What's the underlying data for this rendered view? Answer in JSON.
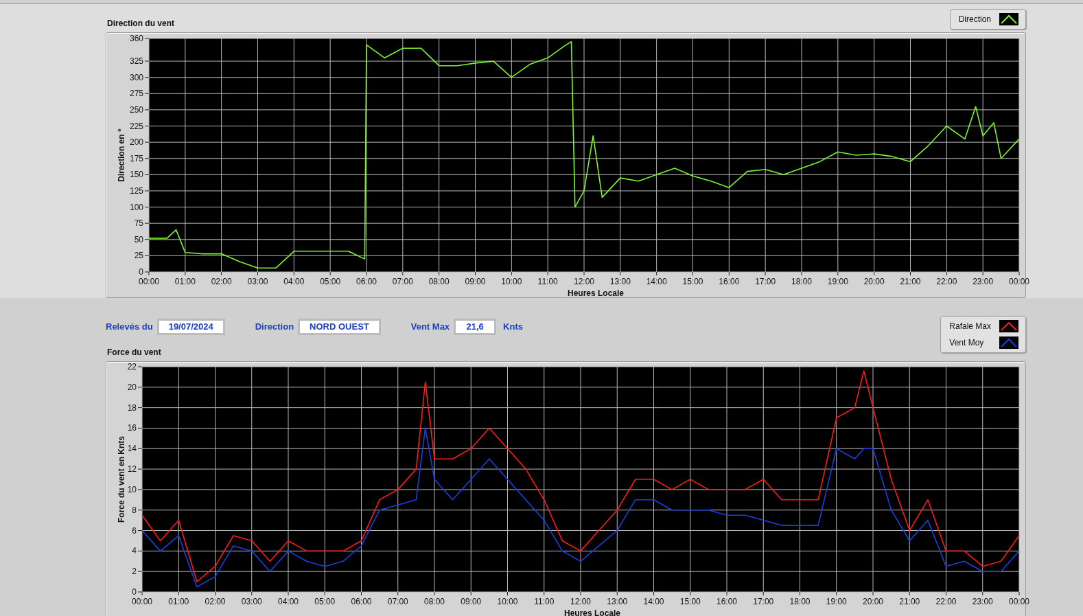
{
  "direction_chart": {
    "title": "Direction du vent",
    "chart_data": {
      "type": "line",
      "grid": true,
      "xlabel": "Heures Locale",
      "ylabel": "Direction en °",
      "xlim": [
        0,
        24
      ],
      "ylim": [
        0,
        360
      ],
      "xticks": [
        {
          "value": 0,
          "label": "00:00"
        },
        {
          "value": 1,
          "label": "01:00"
        },
        {
          "value": 2,
          "label": "02:00"
        },
        {
          "value": 3,
          "label": "03:00"
        },
        {
          "value": 4,
          "label": "04:00"
        },
        {
          "value": 5,
          "label": "05:00"
        },
        {
          "value": 6,
          "label": "06:00"
        },
        {
          "value": 7,
          "label": "07:00"
        },
        {
          "value": 8,
          "label": "08:00"
        },
        {
          "value": 9,
          "label": "09:00"
        },
        {
          "value": 10,
          "label": "10:00"
        },
        {
          "value": 11,
          "label": "11:00"
        },
        {
          "value": 12,
          "label": "12:00"
        },
        {
          "value": 13,
          "label": "13:00"
        },
        {
          "value": 14,
          "label": "14:00"
        },
        {
          "value": 15,
          "label": "15:00"
        },
        {
          "value": 16,
          "label": "16:00"
        },
        {
          "value": 17,
          "label": "17:00"
        },
        {
          "value": 18,
          "label": "18:00"
        },
        {
          "value": 19,
          "label": "19:00"
        },
        {
          "value": 20,
          "label": "20:00"
        },
        {
          "value": 21,
          "label": "21:00"
        },
        {
          "value": 22,
          "label": "22:00"
        },
        {
          "value": 23,
          "label": "23:00"
        },
        {
          "value": 24,
          "label": "00:00"
        }
      ],
      "yticks": [
        0,
        25,
        50,
        75,
        100,
        125,
        150,
        175,
        200,
        225,
        250,
        275,
        300,
        325,
        360
      ],
      "x": [
        0,
        0.5,
        0.75,
        1,
        1.5,
        2,
        2.5,
        3,
        3.5,
        4,
        4.5,
        5,
        5.5,
        5.95,
        6,
        6.5,
        7,
        7.5,
        8,
        8.5,
        9,
        9.5,
        10,
        10.5,
        11,
        11.5,
        11.65,
        11.75,
        12,
        12.25,
        12.5,
        13,
        13.5,
        14,
        14.5,
        15,
        15.5,
        16,
        16.5,
        17,
        17.5,
        18,
        18.5,
        19,
        19.5,
        20,
        20.5,
        21,
        21.5,
        22,
        22.5,
        22.8,
        23,
        23.3,
        23.5,
        24
      ],
      "series": [
        {
          "name": "Direction",
          "color": "#7cf52a",
          "values": [
            52,
            52,
            65,
            30,
            28,
            28,
            16,
            6,
            6,
            32,
            32,
            32,
            32,
            20,
            350,
            330,
            345,
            345,
            318,
            318,
            322,
            325,
            300,
            320,
            330,
            350,
            355,
            100,
            125,
            210,
            115,
            145,
            140,
            150,
            160,
            148,
            140,
            130,
            155,
            158,
            150,
            160,
            170,
            185,
            180,
            182,
            178,
            170,
            195,
            225,
            205,
            255,
            210,
            230,
            175,
            205
          ]
        }
      ]
    }
  },
  "fields": [
    {
      "label": "Relevés du",
      "value": "19/07/2024"
    },
    {
      "label": "Direction",
      "value": "NORD OUEST"
    },
    {
      "label": "Vent Max",
      "value": "21,6",
      "unit": "Knts"
    }
  ],
  "force_chart": {
    "title": "Force du vent",
    "chart_data": {
      "type": "line",
      "grid": true,
      "xlabel": "Heures Locale",
      "ylabel": "Force du vent en Knts",
      "xlim": [
        0,
        24
      ],
      "ylim": [
        0,
        22
      ],
      "xticks": [
        {
          "value": 0,
          "label": "00:00"
        },
        {
          "value": 1,
          "label": "01:00"
        },
        {
          "value": 2,
          "label": "02:00"
        },
        {
          "value": 3,
          "label": "03:00"
        },
        {
          "value": 4,
          "label": "04:00"
        },
        {
          "value": 5,
          "label": "05:00"
        },
        {
          "value": 6,
          "label": "06:00"
        },
        {
          "value": 7,
          "label": "07:00"
        },
        {
          "value": 8,
          "label": "08:00"
        },
        {
          "value": 9,
          "label": "09:00"
        },
        {
          "value": 10,
          "label": "10:00"
        },
        {
          "value": 11,
          "label": "11:00"
        },
        {
          "value": 12,
          "label": "12:00"
        },
        {
          "value": 13,
          "label": "13:00"
        },
        {
          "value": 14,
          "label": "14:00"
        },
        {
          "value": 15,
          "label": "15:00"
        },
        {
          "value": 16,
          "label": "16:00"
        },
        {
          "value": 17,
          "label": "17:00"
        },
        {
          "value": 18,
          "label": "18:00"
        },
        {
          "value": 19,
          "label": "19:00"
        },
        {
          "value": 20,
          "label": "20:00"
        },
        {
          "value": 21,
          "label": "21:00"
        },
        {
          "value": 22,
          "label": "22:00"
        },
        {
          "value": 23,
          "label": "23:00"
        },
        {
          "value": 24,
          "label": "00:00"
        }
      ],
      "yticks": [
        0,
        2,
        4,
        6,
        8,
        10,
        12,
        14,
        16,
        18,
        20,
        22
      ],
      "x": [
        0,
        0.5,
        1,
        1.5,
        2,
        2.5,
        3,
        3.5,
        4,
        4.5,
        5,
        5.5,
        6,
        6.5,
        7,
        7.5,
        7.75,
        8,
        8.5,
        9,
        9.5,
        10,
        10.5,
        11,
        11.5,
        12,
        12.5,
        13,
        13.5,
        14,
        14.5,
        15,
        15.5,
        16,
        16.5,
        17,
        17.5,
        18,
        18.5,
        19,
        19.5,
        19.75,
        20,
        20.5,
        21,
        21.5,
        22,
        22.5,
        23,
        23.5,
        24
      ],
      "series": [
        {
          "name": "Rafale Max",
          "color": "#ff1a1a",
          "values": [
            7.5,
            5,
            7,
            1,
            2.5,
            5.5,
            5,
            3,
            5,
            4,
            4,
            4,
            5,
            9,
            10,
            12,
            20.5,
            13,
            13,
            14,
            16,
            14,
            12,
            9,
            5,
            4,
            6,
            8,
            11,
            11,
            10,
            11,
            10,
            10,
            10,
            11,
            9,
            9,
            9,
            17,
            18,
            21.6,
            18,
            11,
            6,
            9,
            4,
            4,
            2.5,
            3,
            5.5
          ]
        },
        {
          "name": "Vent Moy",
          "color": "#1a3fe0",
          "values": [
            6,
            4,
            5.5,
            0.5,
            1.5,
            4.5,
            4,
            2,
            4,
            3,
            2.5,
            3,
            4.5,
            8,
            8.5,
            9,
            16,
            11,
            9,
            11,
            13,
            11,
            9,
            7,
            4,
            3,
            4.5,
            6,
            9,
            9,
            8,
            8,
            8,
            7.5,
            7.5,
            7,
            6.5,
            6.5,
            6.5,
            14,
            13,
            14,
            14,
            8,
            5,
            7,
            2.5,
            3,
            2,
            2,
            4
          ]
        }
      ]
    }
  }
}
